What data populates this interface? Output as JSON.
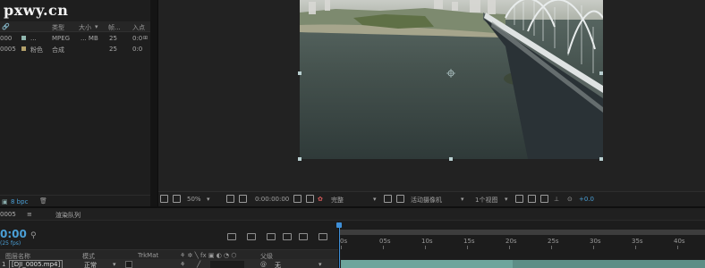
{
  "watermark": "pxwy.cn",
  "project": {
    "headers": [
      "类型",
      "大小",
      "帧...",
      "入点"
    ],
    "items": [
      {
        "name": "000",
        "label": "...",
        "type": "MPEG",
        "size": "... MB",
        "fps": "25",
        "in": "0:0",
        "color": "#8fb5ad"
      },
      {
        "name": "0005",
        "label": "粉色",
        "type": "合成",
        "size": "",
        "fps": "25",
        "in": "0:0",
        "color": "#b2a06a"
      }
    ],
    "bpc": "8 bpc"
  },
  "viewer": {
    "zoom": "50%",
    "timecode": "0:00:00:00",
    "resolution": "完整",
    "camera": "活动摄像机",
    "views": "1个视图",
    "exposure": "+0.0"
  },
  "timeline": {
    "comp_tab": "0005",
    "render_queue_tab": "渲染队列",
    "timecode": "0:00",
    "fps_label": "(25 fps)",
    "columns": {
      "layer_name": "图层名称",
      "mode": "模式",
      "trkmat": "TrkMat",
      "parent": "父级"
    },
    "layer": {
      "number": "1",
      "name": "[DJI_0005.mp4]",
      "mode": "正常",
      "parent": "无"
    },
    "ruler_labels": [
      "0s",
      "05s",
      "10s",
      "15s",
      "20s",
      "25s",
      "30s",
      "35s",
      "40s"
    ]
  },
  "colors": {
    "accent_blue": "#4a9fd6",
    "clip": "#5d8e86",
    "panel": "#1e1e1e"
  }
}
